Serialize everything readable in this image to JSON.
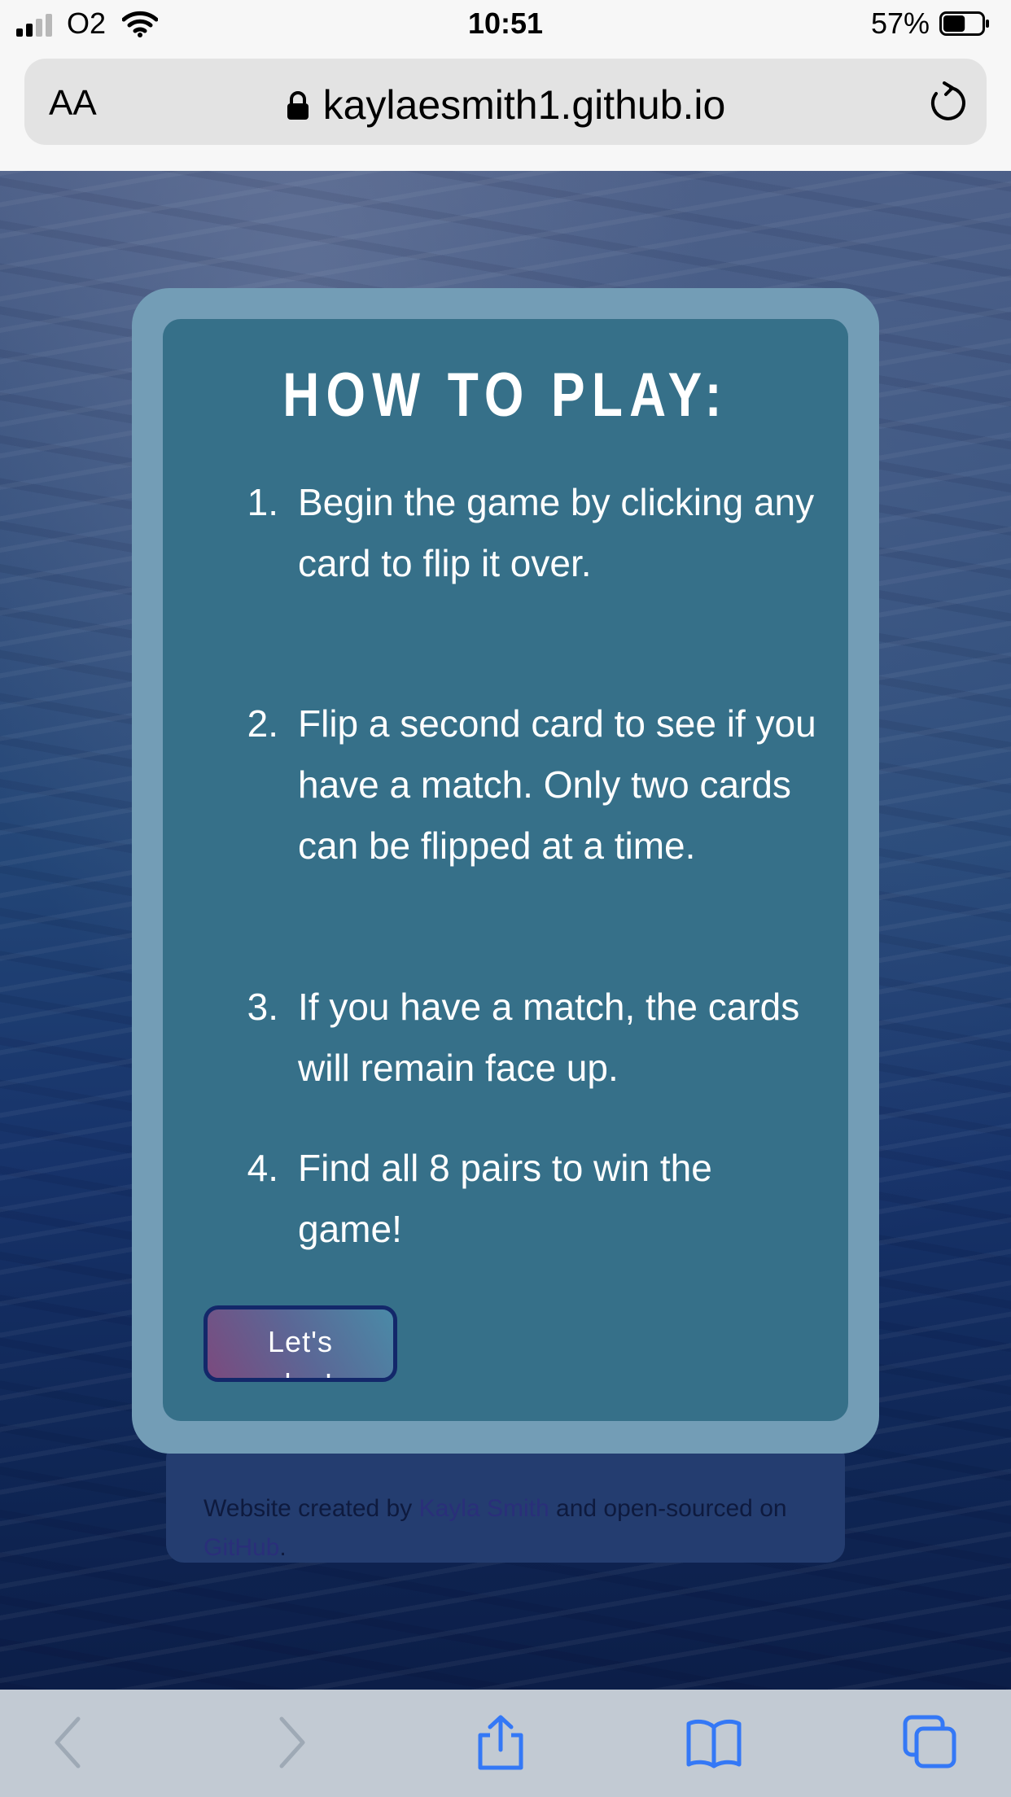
{
  "status_bar": {
    "carrier": "O2",
    "time": "10:51",
    "battery_percent": "57%",
    "battery_level": 0.57,
    "signal_bars": 2
  },
  "browser": {
    "text_size_button": "AA",
    "url": "kaylaesmith1.github.io"
  },
  "modal": {
    "title": "HOW TO PLAY:",
    "rules": [
      {
        "number": "1.",
        "text": "Begin the game by clicking any card to flip it over."
      },
      {
        "number": "2.",
        "text": "Flip a second card to see if you have a match. Only two cards can be flipped at a time."
      },
      {
        "number": "3.",
        "text": "If you have a match, the cards will remain face up."
      },
      {
        "number": "4.",
        "text": "Find all 8 pairs to win the game!"
      }
    ],
    "button_label": "Let's play!"
  },
  "footer": {
    "prefix": "Website created by ",
    "author_link": "Kayla Smith",
    "middle": " and open-sourced on ",
    "github_link": "GitHub",
    "suffix": "."
  },
  "colors": {
    "modal_border": "#739db6",
    "modal_body": "#367089",
    "button_border": "#13286a",
    "toolbar_icon": "#3478f6"
  },
  "toolbar_icons": [
    "back-icon",
    "forward-icon",
    "share-icon",
    "bookmarks-icon",
    "tabs-icon"
  ]
}
